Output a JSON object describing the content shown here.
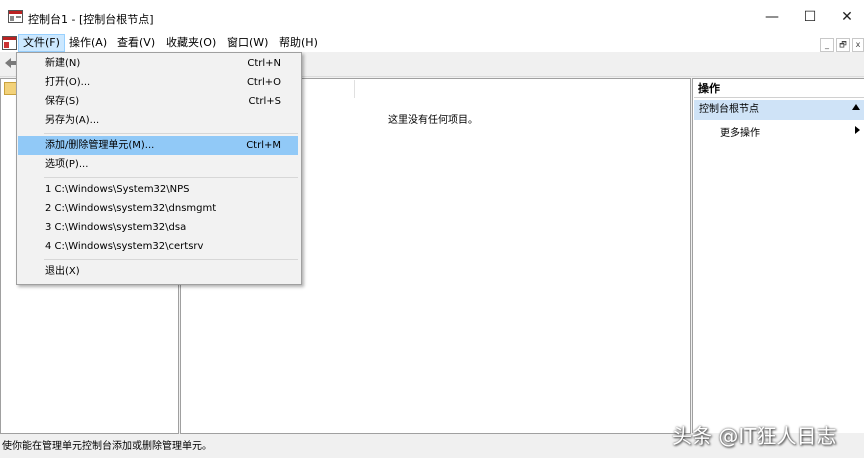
{
  "window": {
    "title": "控制台1 - [控制台根节点]",
    "minimize": "—",
    "maximize": "☐",
    "close": "✕"
  },
  "menubar": {
    "items": [
      "文件(F)",
      "操作(A)",
      "查看(V)",
      "收藏夹(O)",
      "窗口(W)",
      "帮助(H)"
    ],
    "mdi": {
      "min": "_",
      "restore": "🗗",
      "close": "x"
    }
  },
  "file_menu": {
    "items": [
      {
        "label": "新建(N)",
        "shortcut": "Ctrl+N"
      },
      {
        "label": "打开(O)...",
        "shortcut": "Ctrl+O"
      },
      {
        "label": "保存(S)",
        "shortcut": "Ctrl+S"
      },
      {
        "label": "另存为(A)...",
        "shortcut": ""
      },
      {
        "label": "添加/删除管理单元(M)...",
        "shortcut": "Ctrl+M"
      },
      {
        "label": "选项(P)...",
        "shortcut": ""
      },
      {
        "label": "1 C:\\Windows\\System32\\NPS",
        "shortcut": ""
      },
      {
        "label": "2 C:\\Windows\\system32\\dnsmgmt",
        "shortcut": ""
      },
      {
        "label": "3 C:\\Windows\\system32\\dsa",
        "shortcut": ""
      },
      {
        "label": "4 C:\\Windows\\system32\\certsrv",
        "shortcut": ""
      },
      {
        "label": "退出(X)",
        "shortcut": ""
      }
    ]
  },
  "center": {
    "empty_message": "这里没有任何项目。"
  },
  "actions": {
    "title": "操作",
    "root": "控制台根节点",
    "more": "更多操作"
  },
  "status": {
    "text": "使你能在管理单元控制台添加或删除管理单元。"
  },
  "watermark": {
    "text": "头条 @IT狂人日志"
  },
  "colors": {
    "highlight": "#91c9f7",
    "menu_active": "#cce8ff",
    "actions_header": "#cfe3f7"
  }
}
